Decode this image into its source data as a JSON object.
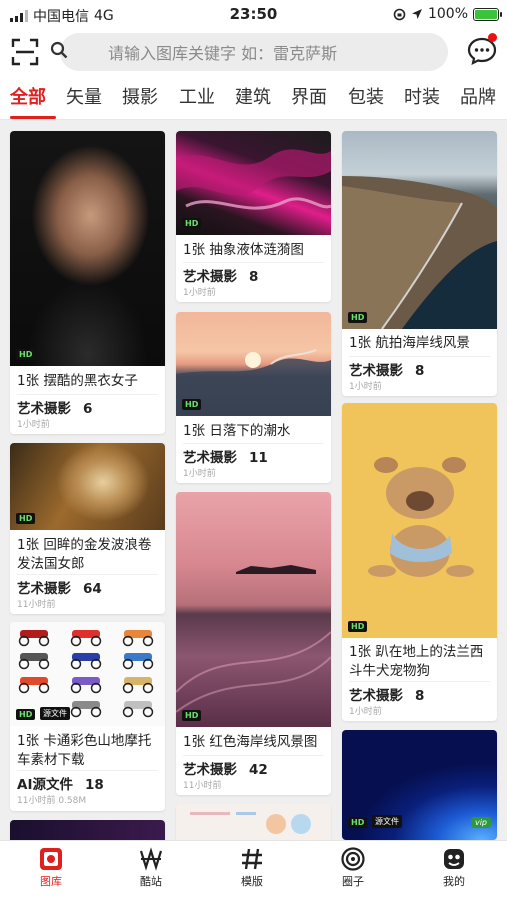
{
  "status_bar": {
    "carrier": "中国电信",
    "network": "4G",
    "time": "23:50",
    "battery": "100%",
    "battery_level": 1.0
  },
  "search": {
    "placeholder": "请输入图库关键字  如：雷克萨斯"
  },
  "tabs": [
    "全部",
    "矢量",
    "摄影",
    "工业",
    "建筑",
    "界面",
    "包装",
    "时装",
    "品牌"
  ],
  "active_tab": "全部",
  "colors": {
    "accent": "#e01f1f",
    "hd_badge": "#6be06b",
    "vip_badge": "#2c9a3c"
  },
  "cards": {
    "c1": {
      "title": "1张 摆酷的黑衣女子",
      "category": "艺术摄影",
      "count": "6",
      "time": "1小时前",
      "badge": "HD"
    },
    "c2": {
      "title": "1张 回眸的金发波浪卷发法国女郎",
      "category": "艺术摄影",
      "count": "64",
      "time": "11小时前",
      "badge": "HD"
    },
    "c3": {
      "title": "1张 卡通彩色山地摩托车素材下载",
      "category": "AI源文件",
      "count": "18",
      "time": "11小时前  0.58M",
      "badge": "HD",
      "badge2": "源文件"
    },
    "c4": {
      "title": "1张 抽象液体涟漪图",
      "category": "艺术摄影",
      "count": "8",
      "time": "1小时前",
      "badge": "HD"
    },
    "c5": {
      "title": "1张 日落下的潮水",
      "category": "艺术摄影",
      "count": "11",
      "time": "1小时前",
      "badge": "HD"
    },
    "c6": {
      "title": "1张 红色海岸线风景图",
      "category": "艺术摄影",
      "count": "42",
      "time": "11小时前",
      "badge": "HD"
    },
    "c7": {
      "title": "1张 航拍海岸线风景",
      "category": "艺术摄影",
      "count": "8",
      "time": "1小时前",
      "badge": "HD"
    },
    "c8": {
      "title": "1张 趴在地上的法兰西斗牛犬宠物狗",
      "category": "艺术摄影",
      "count": "8",
      "time": "1小时前",
      "badge": "HD"
    },
    "c9": {
      "badge": "HD",
      "badge2": "源文件",
      "badge3": "vip"
    }
  },
  "bottom_nav": [
    "图库",
    "酷站",
    "模版",
    "圈子",
    "我的"
  ],
  "bottom_nav_active": "图库"
}
